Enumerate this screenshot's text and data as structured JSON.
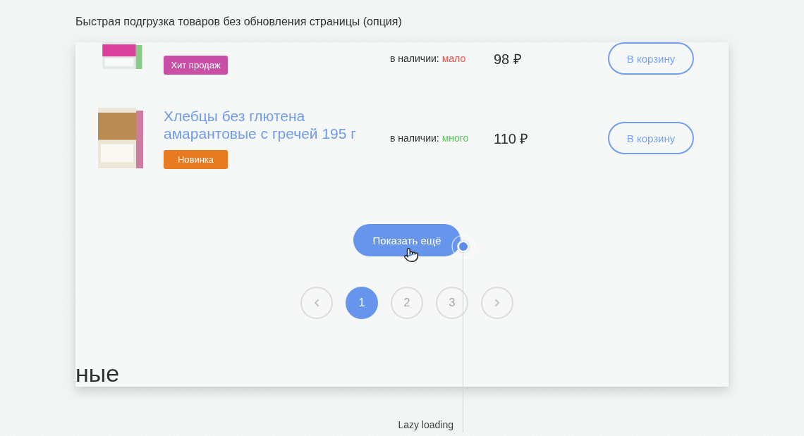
{
  "heading": "Быстрая подгрузка товаров без обновления страницы (опция)",
  "products": [
    {
      "badge": {
        "text": "Хит продаж",
        "color": "#c94fa6"
      },
      "stock": {
        "label": "в наличии:",
        "value": "мало",
        "color": "#e0574f"
      },
      "price": "98 ₽",
      "cart_button": "В корзину"
    },
    {
      "title": "Хлебцы без глютена амарантовые с гречей 195 г",
      "badge": {
        "text": "Новинка",
        "color": "#e87a22"
      },
      "stock": {
        "label": "в наличии:",
        "value": "много",
        "color": "#5cc35c"
      },
      "price": "110 ₽",
      "cart_button": "В корзину"
    }
  ],
  "load_more": "Показать ещё",
  "pagination": {
    "pages": [
      {
        "label": "1",
        "selected": true
      },
      {
        "label": "2",
        "selected": false
      },
      {
        "label": "3",
        "selected": false
      }
    ]
  },
  "section_heading": "ные",
  "annotation": "Lazy loading"
}
